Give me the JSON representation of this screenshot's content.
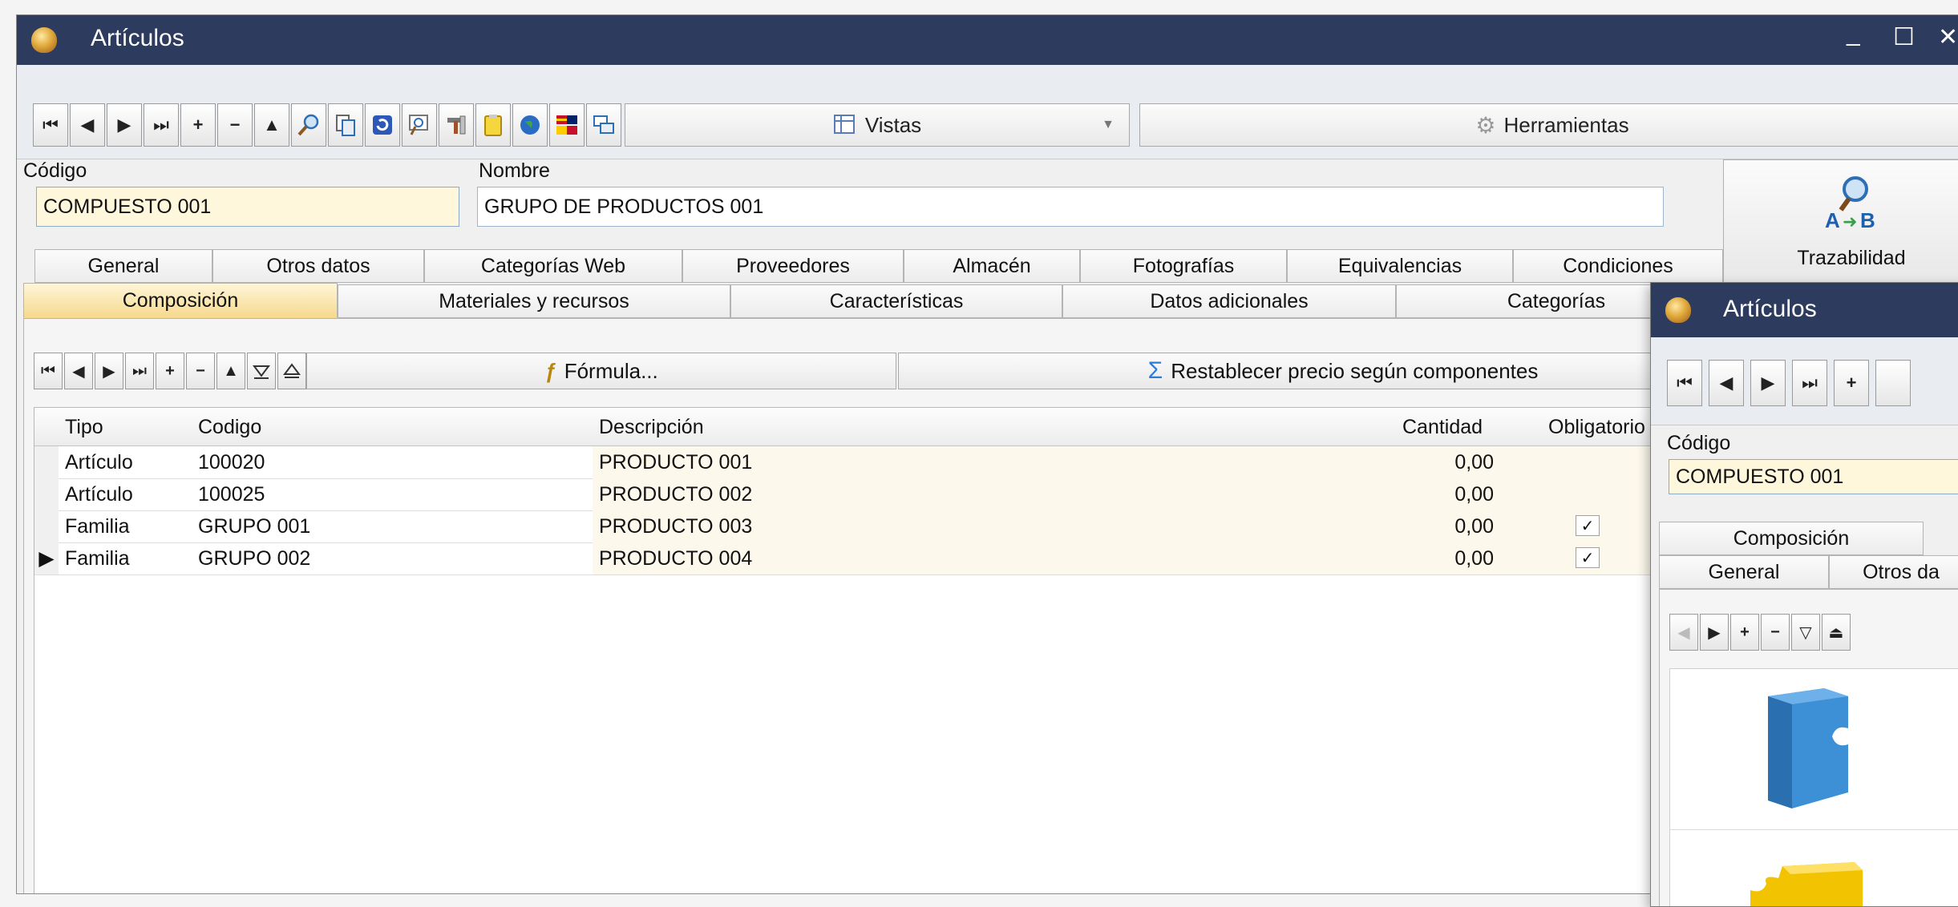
{
  "window": {
    "title": "Artículos",
    "controls": {
      "minimize": "_",
      "maximize": "☐",
      "close": "✕"
    }
  },
  "toolbar": {
    "nav": [
      "⏮",
      "◀",
      "▶",
      "⏭",
      "+",
      "−",
      "▲"
    ],
    "icons": [
      "search-icon",
      "copy-icon",
      "refresh-icon",
      "zoom-icon",
      "tools-icon",
      "clipboard-icon",
      "globe-icon",
      "flags-icon",
      "windows-icon"
    ],
    "vistas_label": "Vistas",
    "herramientas_label": "Herramientas"
  },
  "form": {
    "codigo_label": "Código",
    "codigo_value": "COMPUESTO 001",
    "nombre_label": "Nombre",
    "nombre_value": "GRUPO DE PRODUCTOS 001"
  },
  "side_button": {
    "label": "Trazabilidad"
  },
  "tabs_row1": [
    "General",
    "Otros datos",
    "Categorías Web",
    "Proveedores",
    "Almacén",
    "Fotografías",
    "Equivalencias",
    "Condiciones"
  ],
  "tabs_row2": [
    "Composición",
    "Materiales y recursos",
    "Características",
    "Datos adicionales",
    "Categorías"
  ],
  "sub_toolbar": {
    "formula_label": "Fórmula...",
    "restablecer_label": "Restablecer precio según componentes"
  },
  "grid": {
    "columns": [
      "Tipo",
      "Codigo",
      "Descripción",
      "Cantidad",
      "Obligatorio"
    ],
    "rows": [
      {
        "tipo": "Artículo",
        "codigo": "100020",
        "descripcion": "PRODUCTO 001",
        "cantidad": "0,00",
        "obligatorio": false,
        "current": false
      },
      {
        "tipo": "Artículo",
        "codigo": "100025",
        "descripcion": "PRODUCTO 002",
        "cantidad": "0,00",
        "obligatorio": false,
        "current": false
      },
      {
        "tipo": "Familia",
        "codigo": "GRUPO 001",
        "descripcion": "PRODUCTO 003",
        "cantidad": "0,00",
        "obligatorio": true,
        "current": false
      },
      {
        "tipo": "Familia",
        "codigo": "GRUPO 002",
        "descripcion": "PRODUCTO 004",
        "cantidad": "0,00",
        "obligatorio": true,
        "current": true
      }
    ]
  },
  "window2": {
    "title": "Artículos",
    "codigo_label": "Código",
    "codigo_value": "COMPUESTO 001",
    "tab_composicion": "Composición",
    "tab_general": "General",
    "tab_otros": "Otros da"
  },
  "colors": {
    "titlebar": "#2c3b5e",
    "active_tab": "#f6d98f",
    "field_yellow": "#fff7dc",
    "puzzle_blue": "#3d8fd6",
    "puzzle_yellow": "#f2c300"
  }
}
